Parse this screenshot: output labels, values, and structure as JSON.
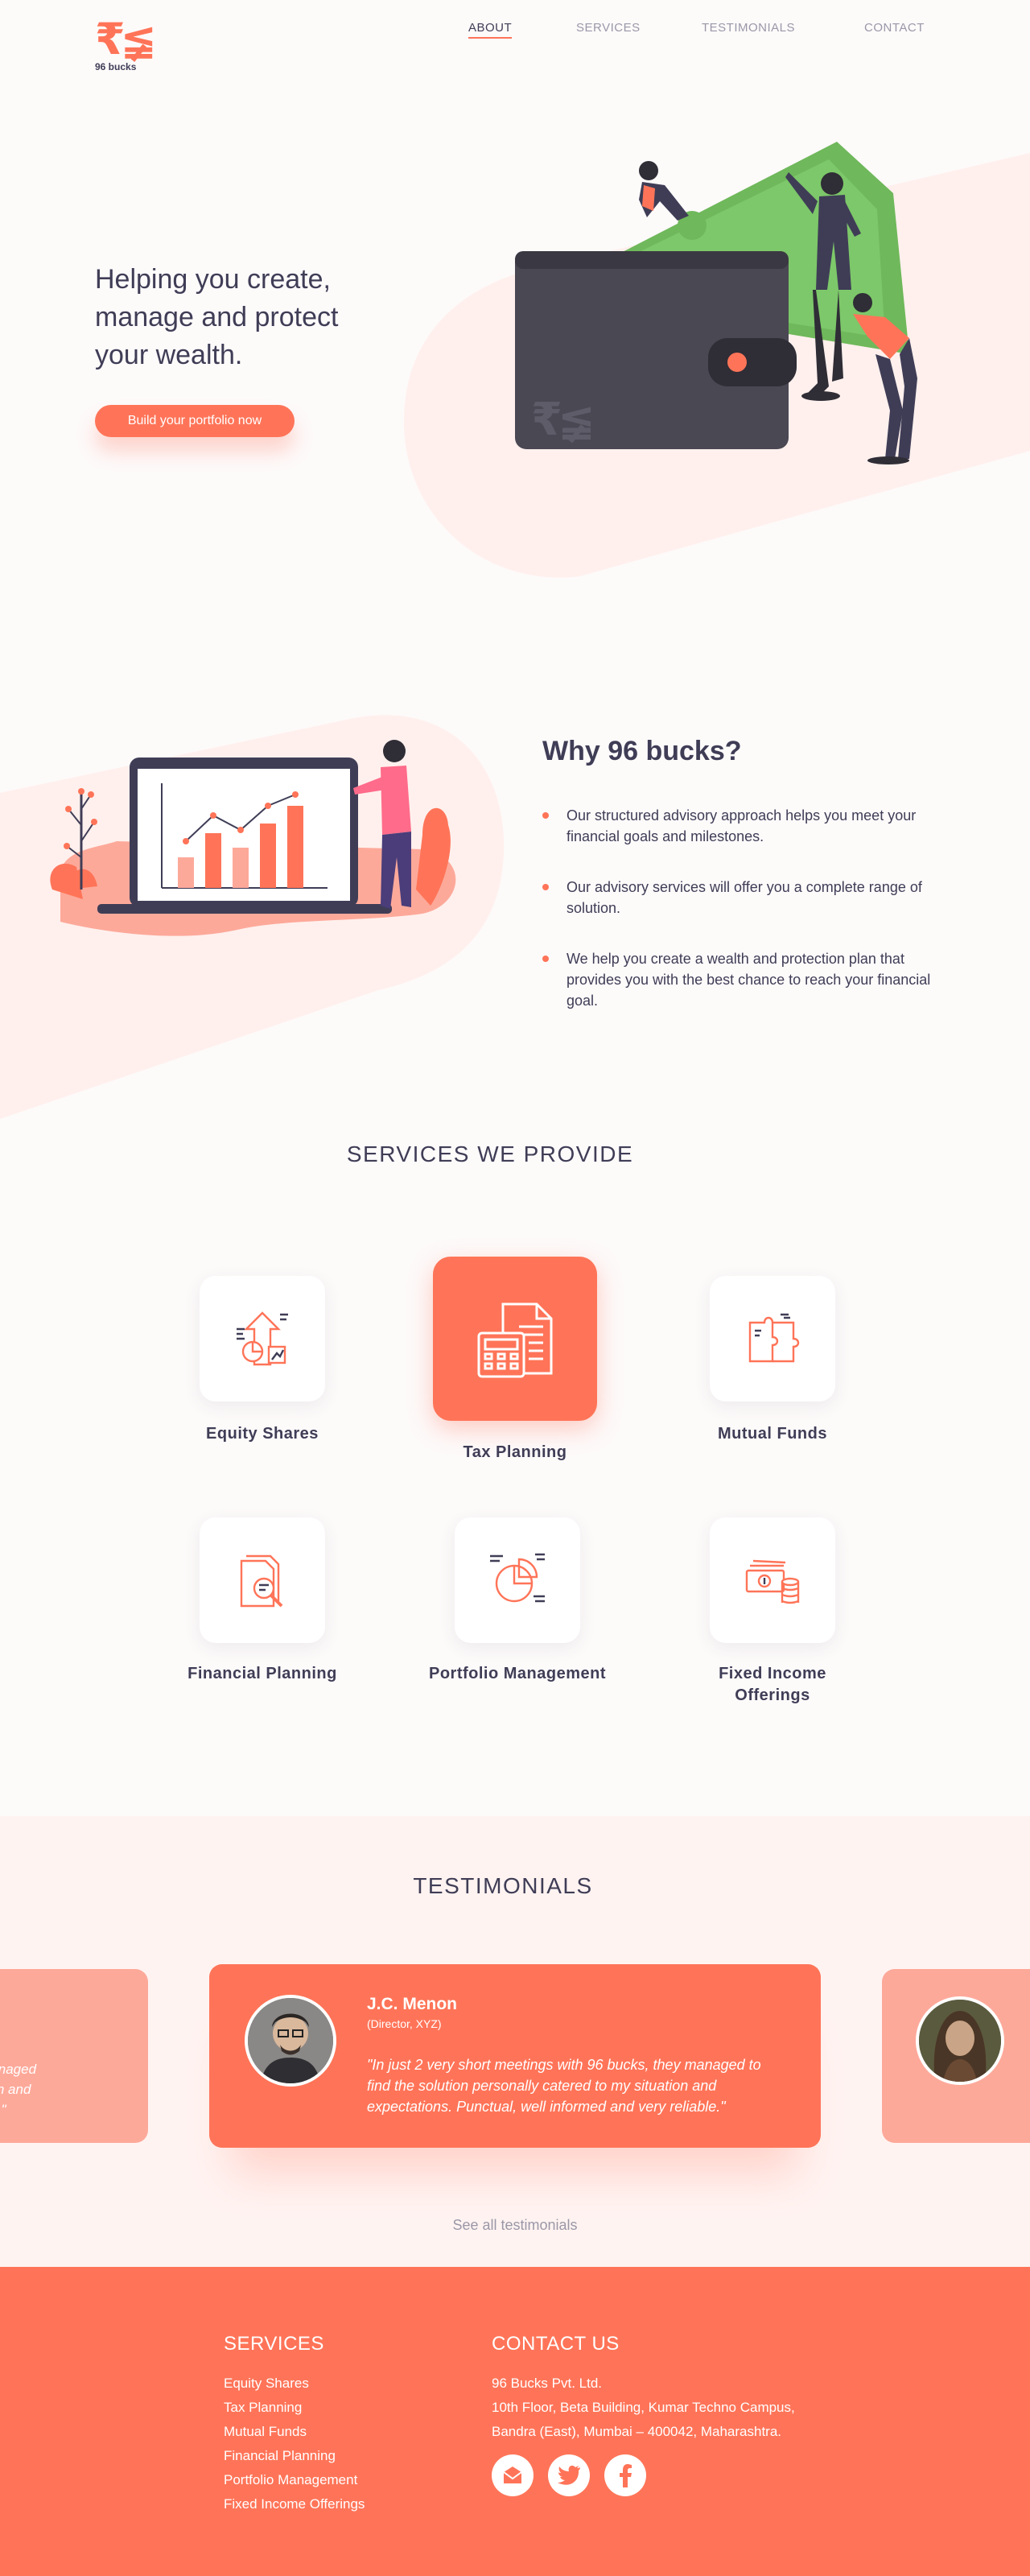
{
  "brand": {
    "mark": "₹≨",
    "name": "96 bucks",
    "accent": "#ff7458",
    "dark": "#3f3d56"
  },
  "nav": [
    {
      "label": "ABOUT",
      "active": true
    },
    {
      "label": "SERVICES",
      "active": false
    },
    {
      "label": "TESTIMONIALS",
      "active": false
    },
    {
      "label": "CONTACT",
      "active": false
    }
  ],
  "hero": {
    "title_lines": [
      "Helping you create,",
      "manage and protect",
      "your wealth."
    ],
    "cta": "Build your portfolio now",
    "wallet_mark": "₹≨"
  },
  "why": {
    "title": "Why 96 bucks?",
    "points": [
      "Our structured advisory approach helps you meet your financial goals and milestones.",
      "Our advisory services will offer you a complete range  of solution.",
      "We help you create a wealth and protection plan that provides you with the best chance to reach your financial goal."
    ]
  },
  "services": {
    "title": "SERVICES WE PROVIDE",
    "items": [
      {
        "label": "Equity Shares",
        "icon": "equity-chart-icon"
      },
      {
        "label": "Tax Planning",
        "icon": "calculator-document-icon",
        "highlighted": true
      },
      {
        "label": "Mutual Funds",
        "icon": "puzzle-icon"
      },
      {
        "label": "Financial Planning",
        "icon": "document-search-icon"
      },
      {
        "label": "Portfolio Management",
        "icon": "pie-chart-icon"
      },
      {
        "label": "Fixed Income Offerings",
        "icon": "cash-coins-icon"
      }
    ]
  },
  "testimonials": {
    "title": "TESTIMONIALS",
    "left_partial_quote": [
      "hey managed",
      "situation and",
      "reliable.\""
    ],
    "active": {
      "name": "J.C. Menon",
      "role": "(Director, XYZ)",
      "quote": "\"In just 2 very short meetings with 96 bucks, they managed to find the solution personally catered to my situation and expectations. Punctual, well informed and very reliable.\""
    },
    "see_all": "See all testimonials"
  },
  "footer": {
    "services_title": "SERVICES",
    "services": [
      "Equity Shares",
      "Tax Planning",
      "Mutual Funds",
      "Financial Planning",
      "Portfolio Management",
      "Fixed Income Offerings"
    ],
    "contact_title": "CONTACT US",
    "contact_lines": [
      "96 Bucks Pvt. Ltd.",
      "10th Floor, Beta Building, Kumar Techno Campus,",
      "Bandra (East), Mumbai – 400042, Maharashtra."
    ],
    "social": [
      "mail-icon",
      "twitter-icon",
      "facebook-icon"
    ]
  }
}
